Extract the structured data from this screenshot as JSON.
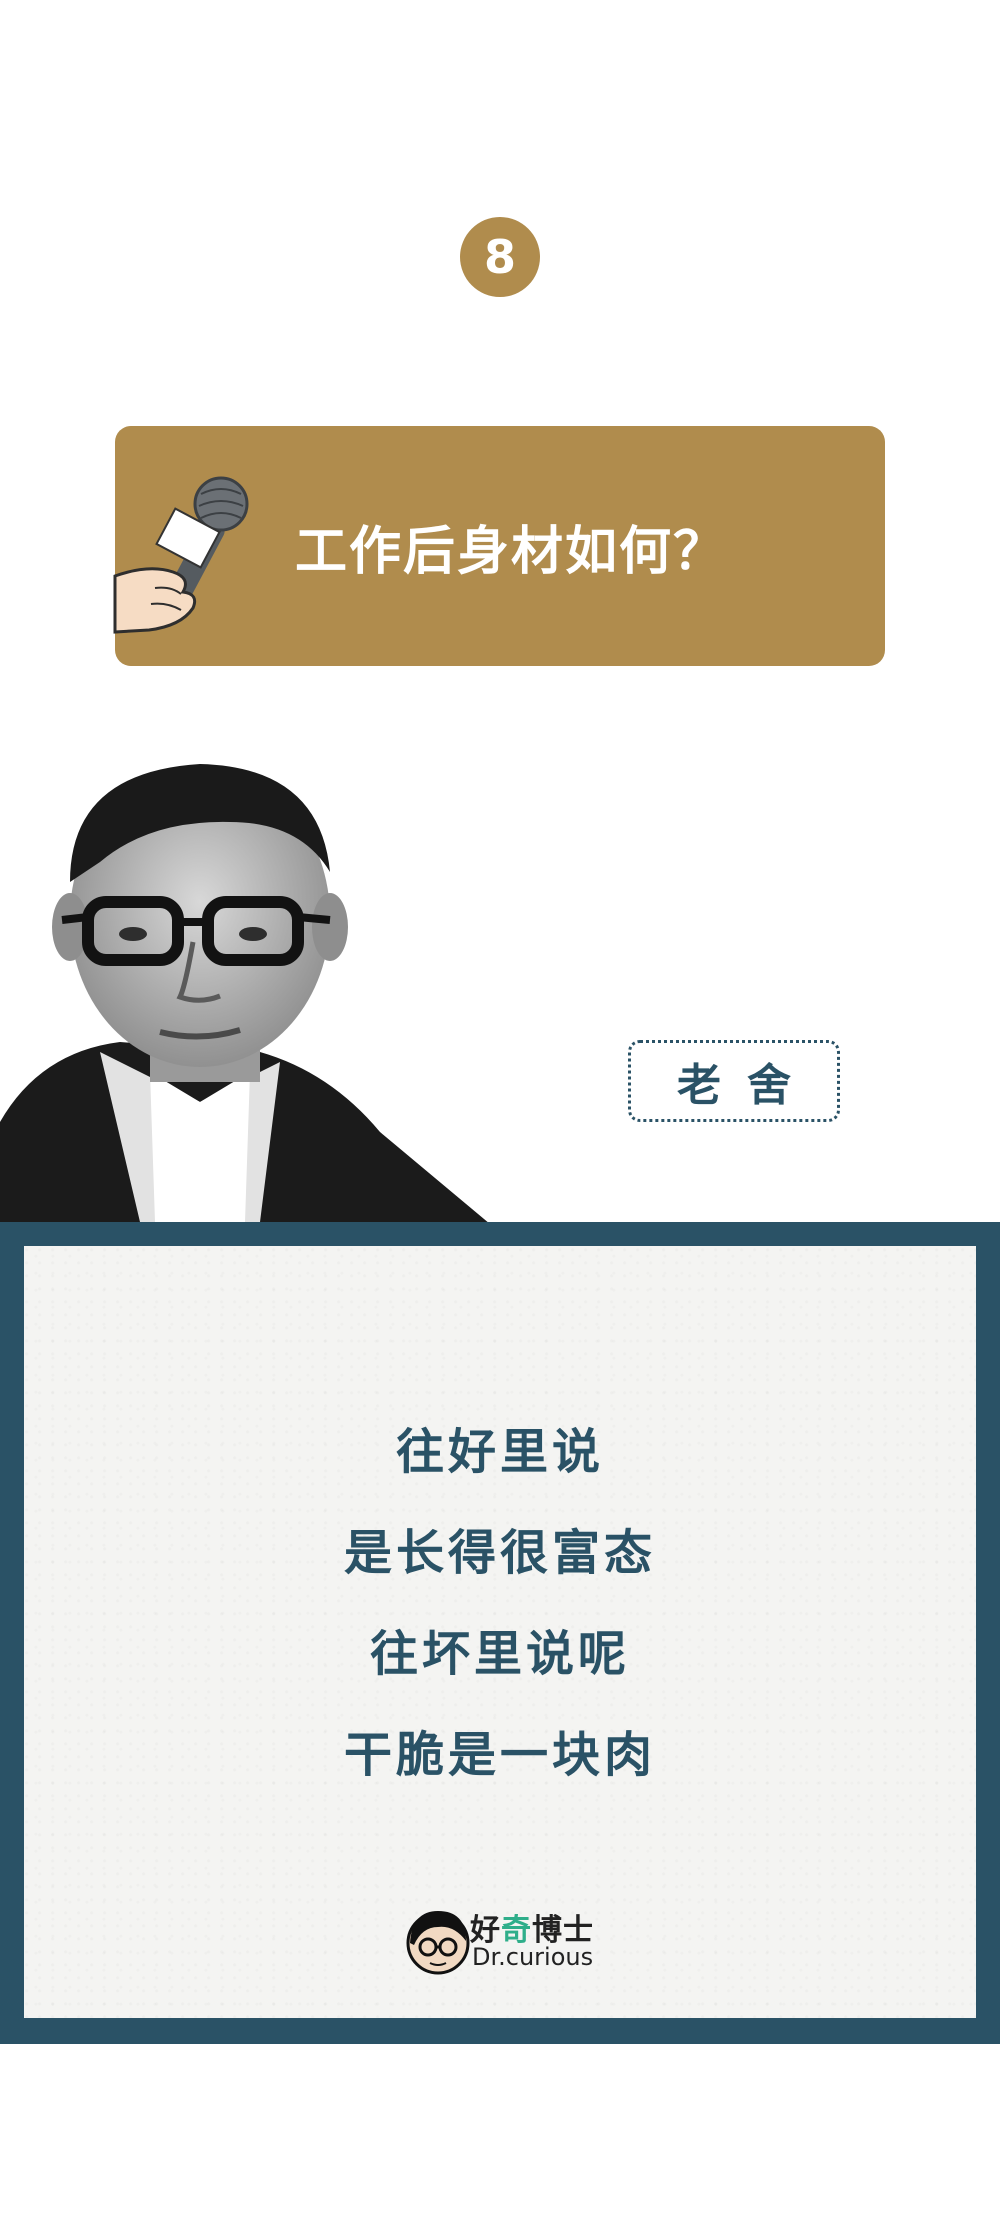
{
  "badge": {
    "number": "8"
  },
  "question": {
    "text": "工作后身材如何？"
  },
  "person": {
    "name": "老舍"
  },
  "quote": {
    "lines": [
      "往好里说",
      "是长得很富态",
      "往坏里说呢",
      "干脆是一块肉"
    ]
  },
  "brand": {
    "name_a": "好",
    "name_b": "奇",
    "name_c": "博士",
    "subtitle": "Dr.curious"
  },
  "colors": {
    "gold": "#b08c4d",
    "navy": "#2a5266",
    "panel": "#f4f4f2",
    "brand_accent": "#2fae8a"
  }
}
